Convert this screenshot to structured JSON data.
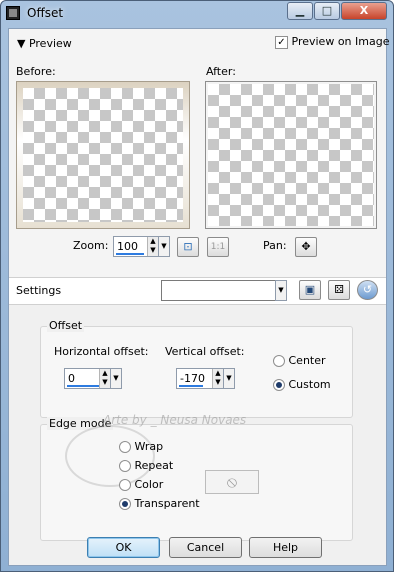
{
  "window": {
    "title": "Offset",
    "min_label": "▁",
    "max_label": "□",
    "close_label": "X"
  },
  "preview": {
    "toggle_label": "▼ Preview",
    "preview_on_image_label": "Preview on Image",
    "preview_on_image_checked": true,
    "before_label": "Before:",
    "after_label": "After:"
  },
  "zoom": {
    "label": "Zoom:",
    "value": "100",
    "one_to_one_label": "1:1"
  },
  "pan": {
    "label": "Pan:"
  },
  "settings": {
    "label": "Settings",
    "preset_value": ""
  },
  "offset": {
    "group_title": "Offset",
    "horizontal_label": "Horizontal offset:",
    "horizontal_value": "0",
    "vertical_label": "Vertical offset:",
    "vertical_value": "-170",
    "center_label": "Center",
    "custom_label": "Custom",
    "selected": "Custom"
  },
  "edge_mode": {
    "group_title": "Edge mode",
    "options": [
      "Wrap",
      "Repeat",
      "Color",
      "Transparent"
    ],
    "selected": "Transparent"
  },
  "buttons": {
    "ok": "OK",
    "cancel": "Cancel",
    "help": "Help"
  },
  "watermark": {
    "text": "Arte by _ Neusa Novaes"
  },
  "colors": {
    "accent": "#2d7be0",
    "title_bar": "#a9c3df",
    "default_button": "#bfe0f6"
  }
}
